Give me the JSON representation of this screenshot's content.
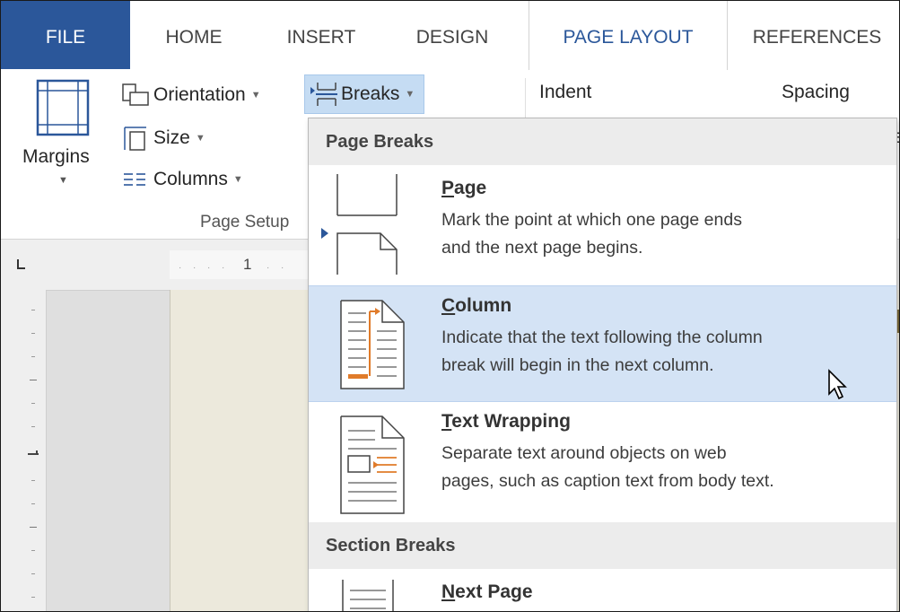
{
  "tabs": [
    "FILE",
    "HOME",
    "INSERT",
    "DESIGN",
    "PAGE LAYOUT",
    "REFERENCES"
  ],
  "ribbon": {
    "margins_label": "Margins",
    "orientation_label": "Orientation",
    "size_label": "Size",
    "columns_label": "Columns",
    "breaks_label": "Breaks",
    "indent_label": "Indent",
    "spacing_label": "Spacing",
    "group_label": "Page Setup"
  },
  "ruler": {
    "tick_1": "1"
  },
  "breaks_menu": {
    "page_breaks_header": "Page Breaks",
    "section_breaks_header": "Section Breaks",
    "items": [
      {
        "title_accel": "P",
        "title_rest": "age",
        "desc1": "Mark the point at which one page ends",
        "desc2": "and the next page begins."
      },
      {
        "title_accel": "C",
        "title_rest": "olumn",
        "desc1": "Indicate that the text following the column",
        "desc2": "break will begin in the next column."
      },
      {
        "title_accel": "T",
        "title_rest": "ext Wrapping",
        "desc1": "Separate text around objects on web",
        "desc2": "pages, such as caption text from body text."
      },
      {
        "title_accel": "N",
        "title_rest": "ext Page",
        "desc1": "",
        "desc2": ""
      }
    ]
  },
  "colors": {
    "accent": "#2b579a",
    "highlight": "#d4e3f5",
    "orange": "#e07b2a"
  }
}
